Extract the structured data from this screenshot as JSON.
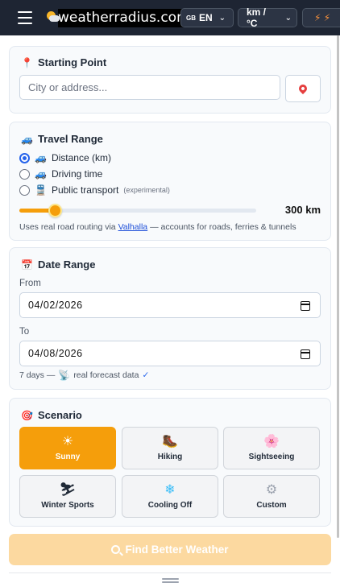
{
  "header": {
    "brand": "weatherradius.com",
    "lang_flag": "GB",
    "lang_label": "EN",
    "units_label": "km / °C",
    "energy_label": "⚡ ⚡"
  },
  "start": {
    "title": "Starting Point",
    "placeholder": "City or address..."
  },
  "travel": {
    "title": "Travel Range",
    "options": [
      {
        "label": "Distance (km)",
        "checked": true
      },
      {
        "label": "Driving time",
        "checked": false
      },
      {
        "label": "Public transport",
        "note": "(experimental)",
        "checked": false
      }
    ],
    "slider_fraction": 0.15,
    "value_label": "300 km",
    "hint_prefix": "Uses real road routing via ",
    "hint_link": "Valhalla",
    "hint_suffix": " — accounts for roads, ferries & tunnels"
  },
  "dates": {
    "title": "Date Range",
    "from_label": "From",
    "from_value": "04/02/2026",
    "to_label": "To",
    "to_value": "04/08/2026",
    "summary": "7 days —",
    "forecast": "real forecast data",
    "check": "✓"
  },
  "scenario": {
    "title": "Scenario",
    "tiles": [
      {
        "label": "Sunny",
        "icon": "☀",
        "active": true
      },
      {
        "label": "Hiking",
        "icon": "🥾",
        "active": false
      },
      {
        "label": "Sightseeing",
        "icon": "🌸",
        "active": false
      },
      {
        "label": "Winter Sports",
        "icon": "⛷",
        "active": false
      },
      {
        "label": "Cooling Off",
        "icon": "❄",
        "active": false
      },
      {
        "label": "Custom",
        "icon": "⚙",
        "active": false
      }
    ]
  },
  "cta": {
    "label": "Find Better Weather"
  },
  "colors": {
    "accent": "#f59e0b",
    "header_bg": "#1e2533",
    "link": "#1d4ed8"
  }
}
